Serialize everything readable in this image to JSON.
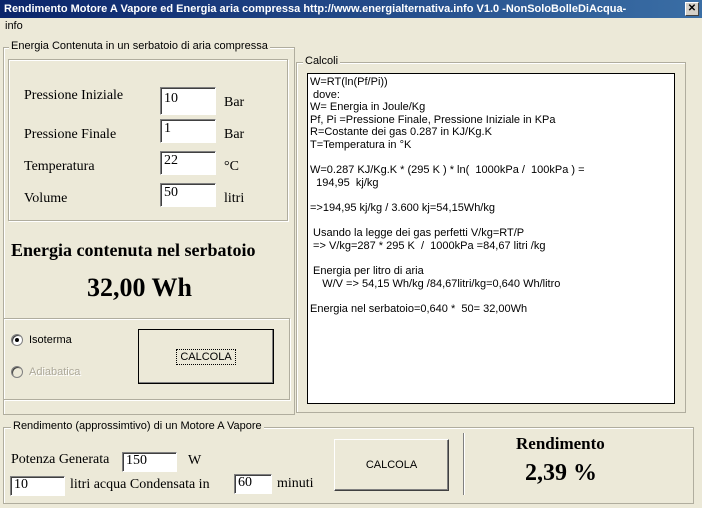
{
  "window": {
    "title": "Rendimento Motore A Vapore ed Energia aria compressa  http://www.energialternativa.info V1.0 -NonSoloBolleDiAcqua-",
    "close_glyph": "✕"
  },
  "menu": {
    "items": [
      "info"
    ]
  },
  "tank_group": {
    "legend": "Energia Contenuta in un serbatoio di aria compressa",
    "fields": [
      {
        "label": "Pressione Iniziale",
        "value": "10",
        "unit": "Bar"
      },
      {
        "label": "Pressione Finale",
        "value": "1",
        "unit": "Bar"
      },
      {
        "label": "Temperatura",
        "value": "22",
        "unit": "°C"
      },
      {
        "label": "Volume",
        "value": "50",
        "unit": "litri"
      }
    ],
    "energy_heading": "Energia contenuta nel serbatoio",
    "energy_value": "32,00 Wh",
    "options": [
      {
        "label": "Isoterma",
        "selected": true,
        "enabled": true
      },
      {
        "label": "Adiabatica",
        "selected": false,
        "enabled": false
      }
    ],
    "calc_button": "CALCOLA"
  },
  "calc_group": {
    "legend": "Calcoli",
    "lines": [
      "W=RT(ln(Pf/Pi))",
      " dove:",
      "W= Energia in Joule/Kg",
      "Pf, Pi =Pressione Finale, Pressione Iniziale in KPa",
      "R=Costante dei gas 0.287 in KJ/Kg.K",
      "T=Temperatura in °K",
      "",
      "W=0.287 KJ/Kg.K * (295 K ) * ln(  1000kPa /  100kPa ) =",
      "  194,95  kj/kg",
      "",
      "=>194,95 kj/kg / 3.600 kj=54,15Wh/kg",
      "",
      " Usando la legge dei gas perfetti V/kg=RT/P",
      " => V/kg=287 * 295 K  /  1000kPa =84,67 litri /kg",
      "",
      " Energia per litro di aria",
      "    W/V => 54,15 Wh/kg /84,67litri/kg=0,640 Wh/litro",
      "",
      "Energia nel serbatoio=0,640 *  50= 32,00Wh"
    ]
  },
  "engine_group": {
    "legend": "Rendimento (approssimtivo) di un Motore A Vapore",
    "power_label": "Potenza Generata",
    "power_value": "150",
    "power_unit": "W",
    "water_value": "10",
    "water_label": "litri acqua Condensata in",
    "minutes_value": "60",
    "minutes_label": "minuti",
    "calc_button": "CALCOLA",
    "result_heading": "Rendimento",
    "result_value": "2,39 %"
  }
}
